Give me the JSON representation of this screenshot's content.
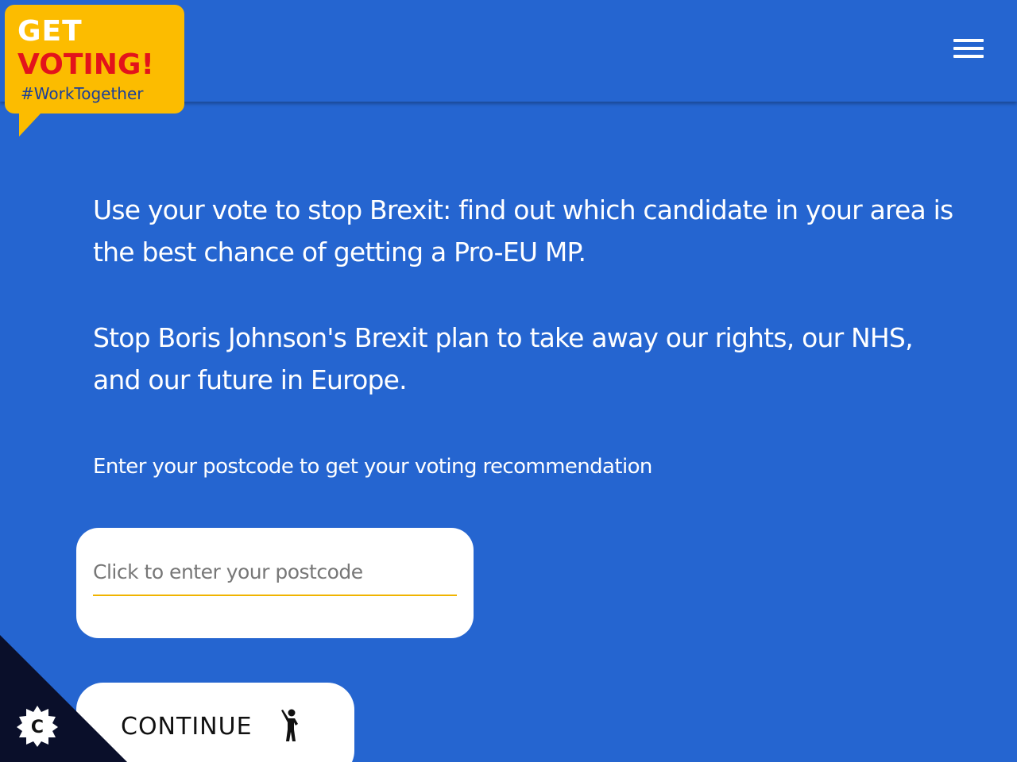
{
  "header": {
    "logo": {
      "line1": "GET",
      "line2": "VOTING!",
      "line3": "#WorkTogether"
    },
    "menu_icon": "hamburger-menu-icon"
  },
  "main": {
    "intro_paragraphs": [
      "Use your vote to stop Brexit: find out which candidate in your area is the best chance of getting a Pro-EU MP.",
      "Stop Boris Johnson's Brexit plan to take away our rights, our NHS, and our future in Europe."
    ],
    "postcode_prompt": "Enter your postcode to get your voting recommendation",
    "postcode_input": {
      "value": "",
      "placeholder": "Click to enter your postcode"
    },
    "continue_button": {
      "label": "CONTINUE",
      "icon": "person-waving-icon"
    }
  },
  "cookie_badge": {
    "letter": "C",
    "icon": "cookie-settings-icon"
  },
  "colors": {
    "background": "#2565d0",
    "logo_yellow": "#fcbc00",
    "logo_red": "#e3131b",
    "logo_navy": "#1b3f99",
    "input_underline": "#f0b400",
    "corner_dark": "#0a0f2a"
  }
}
